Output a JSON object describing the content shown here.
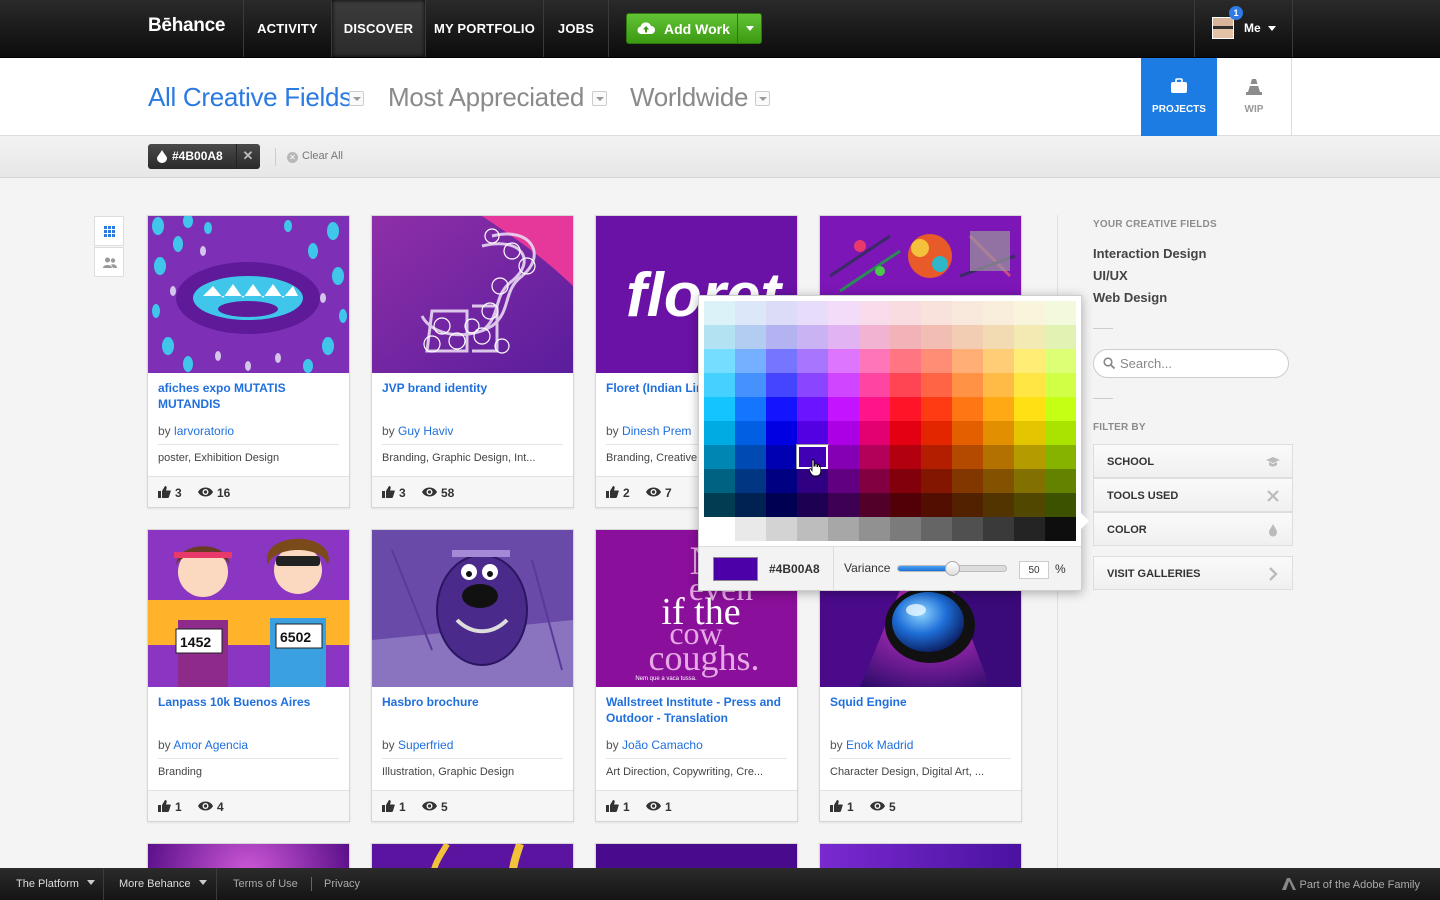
{
  "nav": {
    "logo": "Bēhance",
    "items": [
      "ACTIVITY",
      "DISCOVER",
      "MY PORTFOLIO",
      "JOBS"
    ],
    "active": "DISCOVER",
    "add_work": "Add Work",
    "user_label": "Me",
    "notification_count": "1"
  },
  "filters": {
    "field": "All Creative Fields",
    "sort": "Most Appreciated",
    "location": "Worldwide",
    "tabs": [
      "PROJECTS",
      "WIP"
    ]
  },
  "chips": {
    "color_chip": "#4B00A8",
    "clear_all": "Clear All"
  },
  "projects": [
    {
      "title": "afiches expo MUTATIS MUTANDIS",
      "by": "by",
      "author": "larvoratorio",
      "fields": "poster, Exhibition Design",
      "appreciations": "3",
      "views": "16"
    },
    {
      "title": "JVP brand identity",
      "by": "by",
      "author": "Guy Haviv",
      "fields": "Branding, Graphic Design, Int...",
      "appreciations": "3",
      "views": "58"
    },
    {
      "title": "Floret (Indian Lir",
      "by": "by",
      "author": "Dinesh Prem",
      "fields": "Branding, Creative",
      "appreciations": "2",
      "views": "7"
    },
    {
      "title": "",
      "by": "",
      "author": "",
      "fields": "",
      "appreciations": "",
      "views": ""
    },
    {
      "title": "Lanpass 10k Buenos Aires",
      "by": "by",
      "author": "Amor Agencia",
      "fields": "Branding",
      "appreciations": "1",
      "views": "4"
    },
    {
      "title": "Hasbro brochure",
      "by": "by",
      "author": "Superfried",
      "fields": "Illustration, Graphic Design",
      "appreciations": "1",
      "views": "5"
    },
    {
      "title": "Wallstreet Institute - Press and Outdoor - Translation",
      "by": "by",
      "author": "João Camacho",
      "fields": "Art Direction, Copywriting, Cre...",
      "appreciations": "1",
      "views": "1"
    },
    {
      "title": "Squid Engine",
      "by": "by",
      "author": "Enok Madrid",
      "fields": "Character Design, Digital Art, ...",
      "appreciations": "1",
      "views": "5"
    }
  ],
  "thumb_text": {
    "floret": "floret",
    "bib1": "1452",
    "bib2": "6502",
    "cow_line1": "No",
    "cow_line2": "even",
    "cow_line3": "if the",
    "cow_line4": "cow",
    "cow_line5": "coughs.",
    "cow_small": "Nem que a vaca tussa."
  },
  "sidebar": {
    "fields_heading": "YOUR CREATIVE FIELDS",
    "fields": [
      "Interaction Design",
      "UI/UX",
      "Web Design"
    ],
    "search_placeholder": "Search...",
    "filter_heading": "FILTER BY",
    "filters": [
      "SCHOOL",
      "TOOLS USED",
      "COLOR"
    ],
    "visit_galleries": "VISIT GALLERIES"
  },
  "picker": {
    "selected_hex": "#4B00A8",
    "variance_label": "Variance",
    "variance_value": "50",
    "percent": "%"
  },
  "footer": {
    "platform": "The Platform",
    "more": "More Behance",
    "terms": "Terms of Use",
    "privacy": "Privacy",
    "adobe": "Part of the Adobe Family"
  },
  "colors": {
    "accent_blue": "#2a7ae2",
    "add_work_green": "#4cae23",
    "selected_color": "#4B00A8"
  }
}
